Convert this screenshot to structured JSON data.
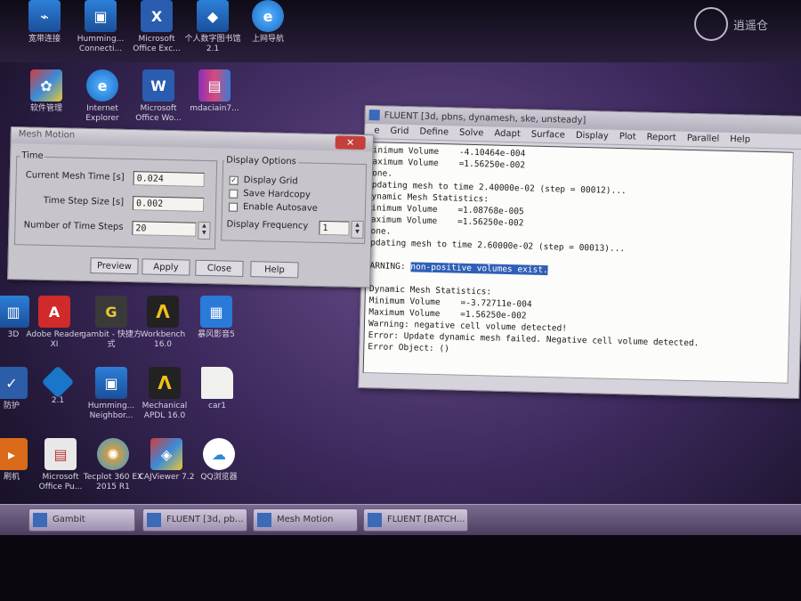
{
  "desktop": {
    "icons": [
      {
        "label": "宽带连接",
        "icon": "network-icon",
        "glyph": "⌁"
      },
      {
        "label": "Humming... Connecti...",
        "icon": "network-app-icon",
        "glyph": "▣"
      },
      {
        "label": "Microsoft Office Exc...",
        "icon": "excel-icon",
        "glyph": "X"
      },
      {
        "label": "个人数字图书馆2.1",
        "icon": "library-icon",
        "glyph": "◆"
      },
      {
        "label": "上网导航",
        "icon": "ie-nav-icon",
        "glyph": "e"
      },
      {
        "label": "软件管理",
        "icon": "software-manager-icon",
        "glyph": "✿"
      },
      {
        "label": "Internet Explorer",
        "icon": "ie-icon",
        "glyph": "e"
      },
      {
        "label": "Microsoft Office Wo...",
        "icon": "word-icon",
        "glyph": "W"
      },
      {
        "label": "mdaciain7...",
        "icon": "winrar-icon",
        "glyph": "▤"
      },
      {
        "label": "Adobe Reader XI",
        "icon": "pdf-icon",
        "glyph": "A"
      },
      {
        "label": "gambit - 快捷方式",
        "icon": "gambit-icon",
        "glyph": "G"
      },
      {
        "label": "Workbench 16.0",
        "icon": "ansys-workbench-icon",
        "glyph": "Λ"
      },
      {
        "label": "暴风影音5",
        "icon": "media-player-icon",
        "glyph": "▦"
      },
      {
        "label": "Humming... Neighbor...",
        "icon": "network-neighbor-icon",
        "glyph": "▣"
      },
      {
        "label": "Mechanical APDL 16.0",
        "icon": "ansys-apdl-icon",
        "glyph": "Λ"
      },
      {
        "label": "car1",
        "icon": "file-icon",
        "glyph": ""
      },
      {
        "label": "Microsoft Office Pu...",
        "icon": "office-icon",
        "glyph": "▤"
      },
      {
        "label": "Tecplot 360 EX 2015 R1",
        "icon": "tecplot-icon",
        "glyph": "✺"
      },
      {
        "label": "CAJViewer 7.2",
        "icon": "cajviewer-icon",
        "glyph": "◈"
      },
      {
        "label": "QQ浏览器",
        "icon": "qq-browser-icon",
        "glyph": "☁"
      },
      {
        "label": "3D",
        "icon": "left-app-icon",
        "glyph": "▥"
      },
      {
        "label": "防护",
        "icon": "security-shield-icon",
        "glyph": "✓"
      },
      {
        "label": "2.1",
        "icon": "kite-app-icon",
        "glyph": ""
      },
      {
        "label": "刷机",
        "icon": "orange-app-icon",
        "glyph": "▸"
      }
    ]
  },
  "mesh_motion": {
    "title": "Mesh Motion",
    "close": "✕",
    "time_group": "Time",
    "current_mesh_time_label": "Current Mesh Time [s]",
    "current_mesh_time_value": "0.024",
    "time_step_size_label": "Time Step Size [s]",
    "time_step_size_value": "0.002",
    "num_time_steps_label": "Number of Time Steps",
    "num_time_steps_value": "20",
    "display_options_group": "Display Options",
    "display_grid_label": "Display Grid",
    "display_grid_checked": "✓",
    "save_hardcopy_label": "Save Hardcopy",
    "enable_autosave_label": "Enable Autosave",
    "display_frequency_label": "Display Frequency",
    "display_frequency_value": "1",
    "buttons": {
      "preview": "Preview",
      "apply": "Apply",
      "close": "Close",
      "help": "Help"
    }
  },
  "fluent": {
    "title": "FLUENT [3d, pbns, dynamesh, ske, unsteady]",
    "menu": [
      "e",
      "Grid",
      "Define",
      "Solve",
      "Adapt",
      "Surface",
      "Display",
      "Plot",
      "Report",
      "Parallel",
      "Help"
    ],
    "console": {
      "l1": "inimum Volume    -4.10464e-004",
      "l2": "aximum Volume    =1.56250e-002",
      "l3": "one.",
      "l4": "pdating mesh to time 2.40000e-02 (step = 00012)...",
      "l5": "ynamic Mesh Statistics:",
      "l6": "inimum Volume    =1.08768e-005",
      "l7": "aximum Volume    =1.56250e-002",
      "l8": "one.",
      "l9": "pdating mesh to time 2.60000e-02 (step = 00013)...",
      "warn_prefix": "ARNING: ",
      "warn_highlight": "non-positive volumes exist.",
      "l10": "Dynamic Mesh Statistics:",
      "l11": "Minimum Volume    =-3.72711e-004",
      "l12": "Maximum Volume    =1.56250e-002",
      "l13": "Warning: negative cell volume detected!",
      "l14": "Error: Update dynamic mesh failed. Negative cell volume detected.",
      "l15": "Error Object: ()"
    }
  },
  "taskbar": {
    "buttons": [
      "Gambit",
      "FLUENT [3d, pb...",
      "Mesh Motion",
      "FLUENT [BATCH..."
    ]
  },
  "watermark": "逍遥仓"
}
